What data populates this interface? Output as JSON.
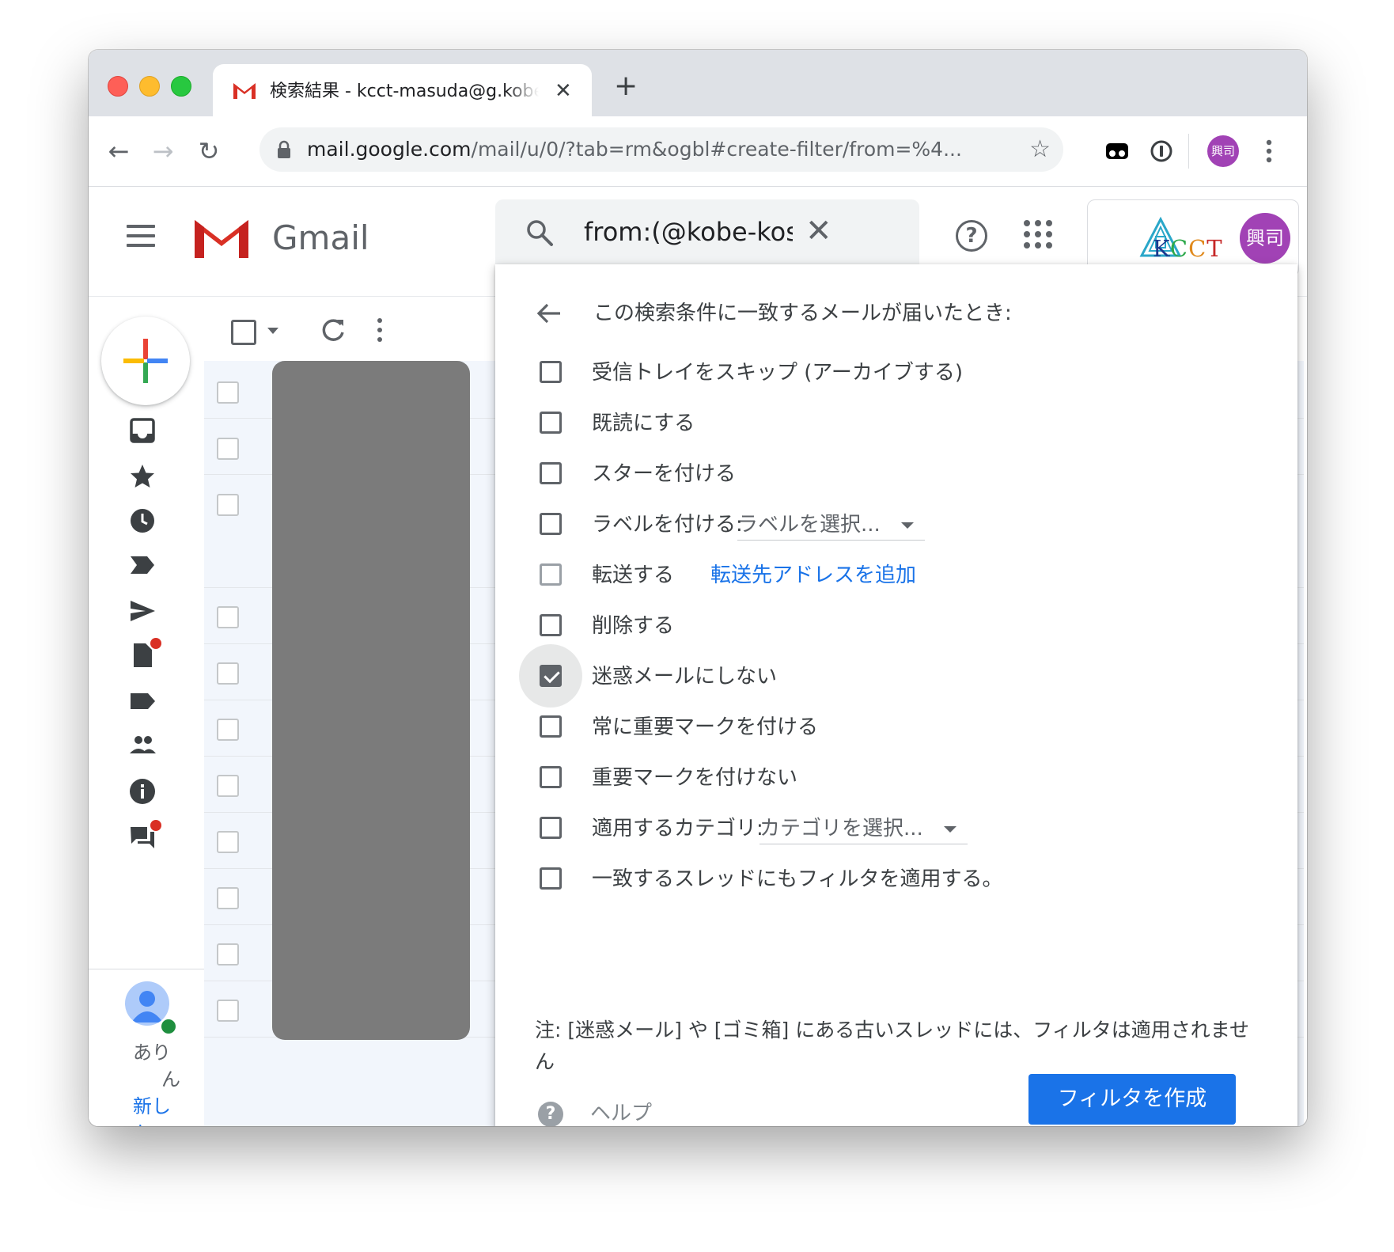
{
  "browser": {
    "tab_title": "検索結果 - kcct-masuda@g.kobe-kosen.ac.jp",
    "tab_close": "✕",
    "new_tab": "+",
    "url_host": "mail.google.com",
    "url_path": "/mail/u/0/?tab=rm&ogbl#create-filter/from=%4...",
    "profile_initials": "興司"
  },
  "gmail": {
    "product_name": "Gmail",
    "search_value": "from:(@kobe-kos",
    "search_clear": "✕",
    "help_symbol": "?",
    "brand_text": {
      "k": "K",
      "c1": "C",
      "c2": "C",
      "t": "T"
    },
    "account_initials": "興司"
  },
  "rail": {
    "status_line1": "あり",
    "status_line2": "ん",
    "link_line1": "新し",
    "link_line2": "ヤッ"
  },
  "filter": {
    "heading": "この検索条件に一致するメールが届いたとき:",
    "options": [
      {
        "label": "受信トレイをスキップ (アーカイブする)",
        "checked": false
      },
      {
        "label": "既読にする",
        "checked": false
      },
      {
        "label": "スターを付ける",
        "checked": false
      },
      {
        "label": "ラベルを付ける:",
        "checked": false,
        "select": "ラベルを選択..."
      },
      {
        "label": "転送する",
        "checked": false,
        "link": "転送先アドレスを追加"
      },
      {
        "label": "削除する",
        "checked": false
      },
      {
        "label": "迷惑メールにしない",
        "checked": true
      },
      {
        "label": "常に重要マークを付ける",
        "checked": false
      },
      {
        "label": "重要マークを付けない",
        "checked": false
      },
      {
        "label": "適用するカテゴリ:",
        "checked": false,
        "select": "カテゴリを選択..."
      },
      {
        "label": "一致するスレッドにもフィルタを適用する。",
        "checked": false
      }
    ],
    "note": "注: [迷惑メール] や [ゴミ箱] にある古いスレッドには、フィルタは適用されません",
    "help_symbol": "?",
    "help_label": "ヘルプ",
    "create_button": "フィルタを作成"
  },
  "colors": {
    "accent": "#1a73e8",
    "avatar": "#a142b5",
    "notification_dot": "#d93025",
    "tab_strip": "#dee1e6"
  }
}
